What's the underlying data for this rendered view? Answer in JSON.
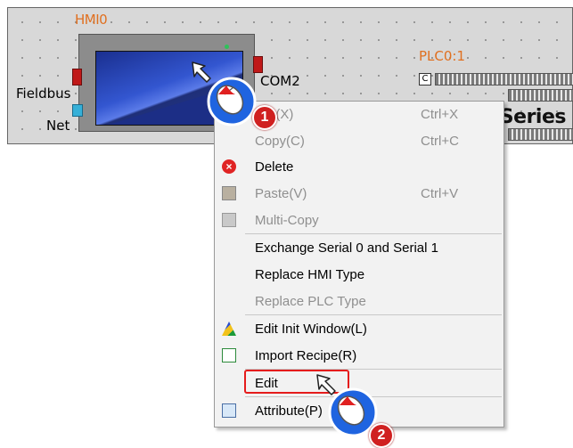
{
  "canvas": {
    "hmi_label": "HMI0",
    "fieldbus_label": "Fieldbus",
    "net_label": "Net",
    "com2_label": "COM2",
    "plc_label": "PLC0:1",
    "plc_series_text": "C Series"
  },
  "context_menu": {
    "items": [
      {
        "label": "Cut(X)",
        "shortcut": "Ctrl+X",
        "enabled": false
      },
      {
        "label": "Copy(C)",
        "shortcut": "Ctrl+C",
        "enabled": false
      },
      {
        "label": "Delete",
        "shortcut": "",
        "enabled": true,
        "icon": "delete-icon"
      },
      {
        "label": "Paste(V)",
        "shortcut": "Ctrl+V",
        "enabled": false,
        "icon": "paste-icon"
      },
      {
        "label": "Multi-Copy",
        "shortcut": "",
        "enabled": false,
        "icon": "multi-copy-icon"
      },
      {
        "label": "Exchange Serial 0 and Serial 1",
        "shortcut": "",
        "enabled": true
      },
      {
        "label": "Replace HMI Type",
        "shortcut": "",
        "enabled": true
      },
      {
        "label": "Replace PLC Type",
        "shortcut": "",
        "enabled": false
      },
      {
        "label": "Edit Init Window(L)",
        "shortcut": "",
        "enabled": true,
        "icon": "init-window-icon"
      },
      {
        "label": "Import Recipe(R)",
        "shortcut": "",
        "enabled": true,
        "icon": "import-recipe-icon"
      },
      {
        "label": "Edit",
        "shortcut": "",
        "enabled": true,
        "highlighted": true
      },
      {
        "label": "Attribute(P)",
        "shortcut": "",
        "enabled": true,
        "icon": "attribute-icon"
      }
    ]
  },
  "annotations": {
    "step1": "1",
    "step2": "2"
  },
  "colors": {
    "accent_orange": "#e07020",
    "highlight_red": "#e51c1c",
    "cursor_blue": "#1f64e0"
  }
}
